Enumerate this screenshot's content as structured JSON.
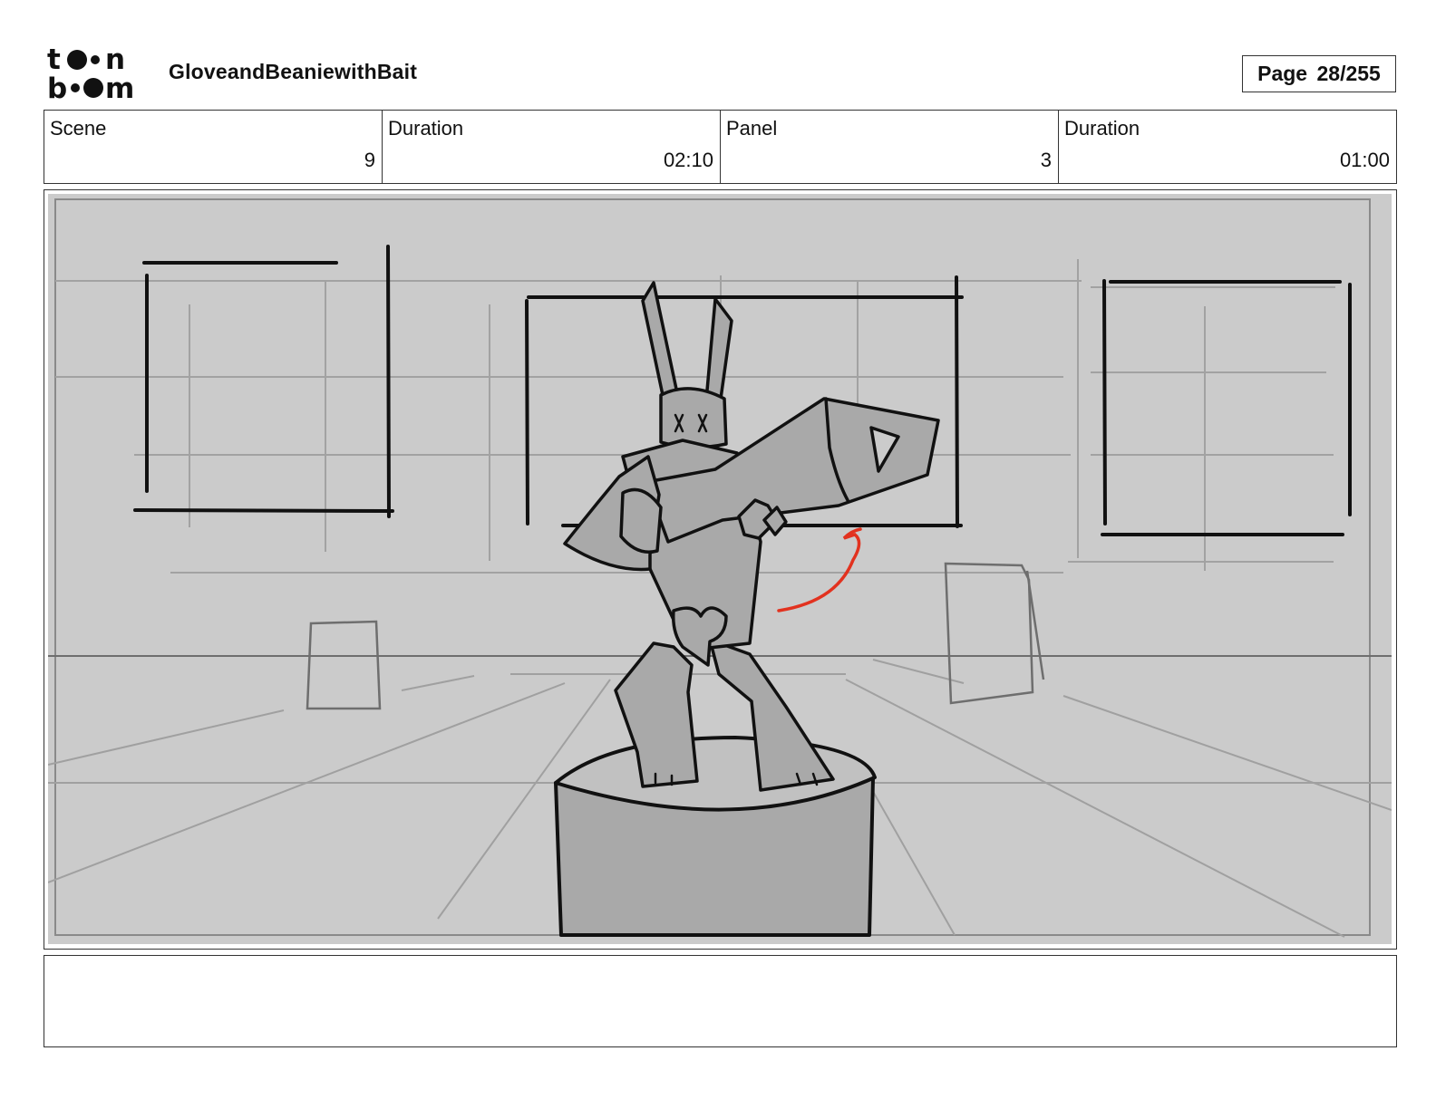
{
  "header": {
    "project_title": "GloveandBeaniewithBait",
    "page_label": "Page",
    "page_number": "28/255"
  },
  "logo": {
    "name": "toon boom logo",
    "line1": "toon",
    "line2": "boom"
  },
  "info": {
    "scene_label": "Scene",
    "scene_value": "9",
    "scene_duration_label": "Duration",
    "scene_duration_value": "02:10",
    "panel_label": "Panel",
    "panel_value": "3",
    "panel_duration_label": "Duration",
    "panel_duration_value": "01:00"
  },
  "panel": {
    "description": "",
    "colors": {
      "background": "#cbcbcb",
      "shape_fill": "#a9a9a9",
      "ink": "#111111",
      "guide": "#9a9a9a",
      "motion_arrow": "#e2321f"
    }
  },
  "notes": {
    "text": ""
  }
}
